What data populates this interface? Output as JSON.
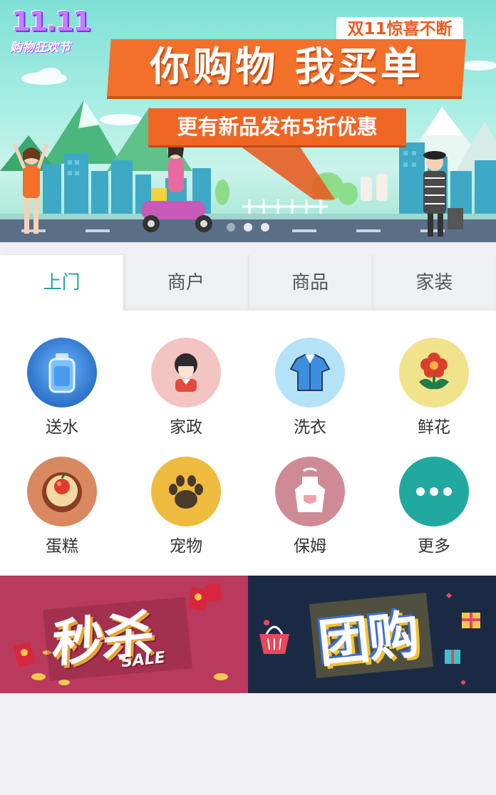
{
  "banner": {
    "logo_digits": "11.11",
    "logo_sub": "购物狂欢节",
    "badge": "双11惊喜不断",
    "headline": "你购物 我买单",
    "subline": "更有新品发布5折优惠",
    "carousel_dots": 3,
    "active_dot": 0
  },
  "tabs": [
    {
      "label": "上门",
      "active": true
    },
    {
      "label": "商户",
      "active": false
    },
    {
      "label": "商品",
      "active": false
    },
    {
      "label": "家装",
      "active": false
    }
  ],
  "services": [
    {
      "label": "送水",
      "icon": "water-bottle-icon",
      "color": "#2b72c9"
    },
    {
      "label": "家政",
      "icon": "housekeeper-icon",
      "color": "#f3c4c1"
    },
    {
      "label": "洗衣",
      "icon": "shirt-icon",
      "color": "#b4e3f7"
    },
    {
      "label": "鲜花",
      "icon": "flower-icon",
      "color": "#f1e28c"
    },
    {
      "label": "蛋糕",
      "icon": "cake-icon",
      "color": "#d98860"
    },
    {
      "label": "宠物",
      "icon": "paw-icon",
      "color": "#efbb3f"
    },
    {
      "label": "保姆",
      "icon": "apron-icon",
      "color": "#cf8b95"
    },
    {
      "label": "更多",
      "icon": "more-dots-icon",
      "color": "#22a99f"
    }
  ],
  "promos": {
    "seckill": {
      "title": "秒杀",
      "tag": "SALE",
      "bg": "#b93a5c"
    },
    "group": {
      "title": "团购",
      "bg": "#1b2a44"
    }
  },
  "accent_color": "#22a4a0"
}
